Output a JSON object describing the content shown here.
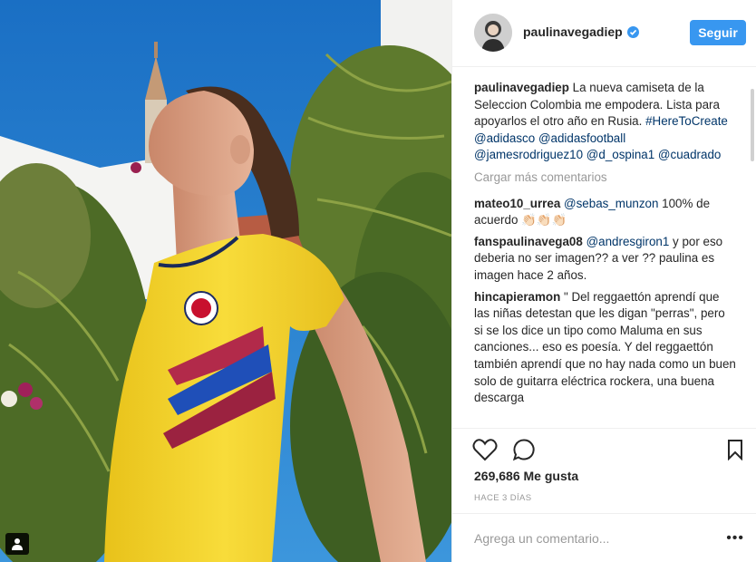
{
  "post": {
    "username": "paulinavegadiep",
    "follow_label": "Seguir",
    "caption": {
      "user": "paulinavegadiep",
      "text": " La nueva camiseta de la Seleccion Colombia me empodera. Lista para apoyarlos el otro año en Rusia. ",
      "tags": [
        "#HereToCreate",
        "@adidasco",
        "@adidasfootball",
        "@jamesrodriguez10",
        "@d_ospina1",
        "@cuadrado"
      ]
    },
    "load_more": "Cargar más comentarios",
    "comments": [
      {
        "user": "mateo10_urrea",
        "mention": "@sebas_munzon",
        "text": " 100% de acuerdo 👏🏻👏🏻👏🏻"
      },
      {
        "user": "fanspaulinavega08",
        "mention": "@andresgiron1",
        "text": " y por eso deberia no ser imagen?? a ver ?? paulina es imagen hace 2 años."
      },
      {
        "user": "hincapieramon",
        "mention": "",
        "text": " \" Del reggaettón aprendí que las niñas detestan que les digan \"perras\", pero si se los dice un tipo como Maluma en sus canciones... eso es poesía. Y del reggaettón también aprendí que no hay nada como un buen solo de guitarra eléctrica rockera, una buena descarga"
      }
    ],
    "likes": "269,686 Me gusta",
    "time": "HACE 3 DÍAS",
    "add_comment_placeholder": "Agrega un comentario...",
    "icons": {
      "like": "heart-icon",
      "comment": "comment-icon",
      "save": "bookmark-icon",
      "more": "more-options-icon",
      "verified": "verified-badge-icon",
      "tag": "user-tag-icon"
    },
    "colors": {
      "accent": "#3897f0",
      "link": "#003569",
      "muted": "#999999",
      "jersey": "#f6d52b"
    }
  }
}
